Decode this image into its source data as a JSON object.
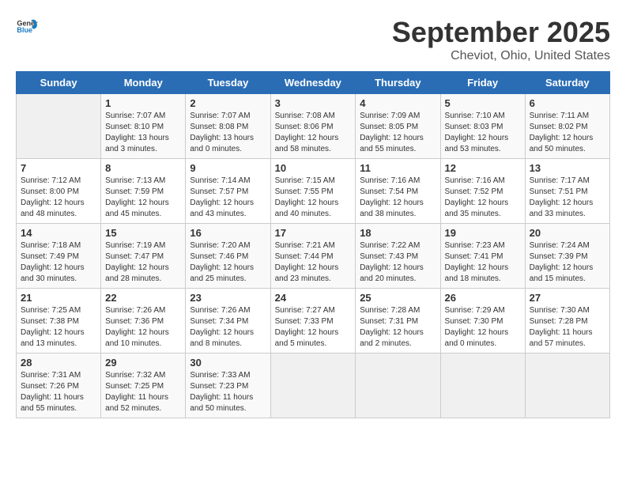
{
  "logo": {
    "general": "General",
    "blue": "Blue"
  },
  "header": {
    "month": "September 2025",
    "location": "Cheviot, Ohio, United States"
  },
  "weekdays": [
    "Sunday",
    "Monday",
    "Tuesday",
    "Wednesday",
    "Thursday",
    "Friday",
    "Saturday"
  ],
  "weeks": [
    [
      {
        "day": "",
        "info": ""
      },
      {
        "day": "1",
        "info": "Sunrise: 7:07 AM\nSunset: 8:10 PM\nDaylight: 13 hours\nand 3 minutes."
      },
      {
        "day": "2",
        "info": "Sunrise: 7:07 AM\nSunset: 8:08 PM\nDaylight: 13 hours\nand 0 minutes."
      },
      {
        "day": "3",
        "info": "Sunrise: 7:08 AM\nSunset: 8:06 PM\nDaylight: 12 hours\nand 58 minutes."
      },
      {
        "day": "4",
        "info": "Sunrise: 7:09 AM\nSunset: 8:05 PM\nDaylight: 12 hours\nand 55 minutes."
      },
      {
        "day": "5",
        "info": "Sunrise: 7:10 AM\nSunset: 8:03 PM\nDaylight: 12 hours\nand 53 minutes."
      },
      {
        "day": "6",
        "info": "Sunrise: 7:11 AM\nSunset: 8:02 PM\nDaylight: 12 hours\nand 50 minutes."
      }
    ],
    [
      {
        "day": "7",
        "info": "Sunrise: 7:12 AM\nSunset: 8:00 PM\nDaylight: 12 hours\nand 48 minutes."
      },
      {
        "day": "8",
        "info": "Sunrise: 7:13 AM\nSunset: 7:59 PM\nDaylight: 12 hours\nand 45 minutes."
      },
      {
        "day": "9",
        "info": "Sunrise: 7:14 AM\nSunset: 7:57 PM\nDaylight: 12 hours\nand 43 minutes."
      },
      {
        "day": "10",
        "info": "Sunrise: 7:15 AM\nSunset: 7:55 PM\nDaylight: 12 hours\nand 40 minutes."
      },
      {
        "day": "11",
        "info": "Sunrise: 7:16 AM\nSunset: 7:54 PM\nDaylight: 12 hours\nand 38 minutes."
      },
      {
        "day": "12",
        "info": "Sunrise: 7:16 AM\nSunset: 7:52 PM\nDaylight: 12 hours\nand 35 minutes."
      },
      {
        "day": "13",
        "info": "Sunrise: 7:17 AM\nSunset: 7:51 PM\nDaylight: 12 hours\nand 33 minutes."
      }
    ],
    [
      {
        "day": "14",
        "info": "Sunrise: 7:18 AM\nSunset: 7:49 PM\nDaylight: 12 hours\nand 30 minutes."
      },
      {
        "day": "15",
        "info": "Sunrise: 7:19 AM\nSunset: 7:47 PM\nDaylight: 12 hours\nand 28 minutes."
      },
      {
        "day": "16",
        "info": "Sunrise: 7:20 AM\nSunset: 7:46 PM\nDaylight: 12 hours\nand 25 minutes."
      },
      {
        "day": "17",
        "info": "Sunrise: 7:21 AM\nSunset: 7:44 PM\nDaylight: 12 hours\nand 23 minutes."
      },
      {
        "day": "18",
        "info": "Sunrise: 7:22 AM\nSunset: 7:43 PM\nDaylight: 12 hours\nand 20 minutes."
      },
      {
        "day": "19",
        "info": "Sunrise: 7:23 AM\nSunset: 7:41 PM\nDaylight: 12 hours\nand 18 minutes."
      },
      {
        "day": "20",
        "info": "Sunrise: 7:24 AM\nSunset: 7:39 PM\nDaylight: 12 hours\nand 15 minutes."
      }
    ],
    [
      {
        "day": "21",
        "info": "Sunrise: 7:25 AM\nSunset: 7:38 PM\nDaylight: 12 hours\nand 13 minutes."
      },
      {
        "day": "22",
        "info": "Sunrise: 7:26 AM\nSunset: 7:36 PM\nDaylight: 12 hours\nand 10 minutes."
      },
      {
        "day": "23",
        "info": "Sunrise: 7:26 AM\nSunset: 7:34 PM\nDaylight: 12 hours\nand 8 minutes."
      },
      {
        "day": "24",
        "info": "Sunrise: 7:27 AM\nSunset: 7:33 PM\nDaylight: 12 hours\nand 5 minutes."
      },
      {
        "day": "25",
        "info": "Sunrise: 7:28 AM\nSunset: 7:31 PM\nDaylight: 12 hours\nand 2 minutes."
      },
      {
        "day": "26",
        "info": "Sunrise: 7:29 AM\nSunset: 7:30 PM\nDaylight: 12 hours\nand 0 minutes."
      },
      {
        "day": "27",
        "info": "Sunrise: 7:30 AM\nSunset: 7:28 PM\nDaylight: 11 hours\nand 57 minutes."
      }
    ],
    [
      {
        "day": "28",
        "info": "Sunrise: 7:31 AM\nSunset: 7:26 PM\nDaylight: 11 hours\nand 55 minutes."
      },
      {
        "day": "29",
        "info": "Sunrise: 7:32 AM\nSunset: 7:25 PM\nDaylight: 11 hours\nand 52 minutes."
      },
      {
        "day": "30",
        "info": "Sunrise: 7:33 AM\nSunset: 7:23 PM\nDaylight: 11 hours\nand 50 minutes."
      },
      {
        "day": "",
        "info": ""
      },
      {
        "day": "",
        "info": ""
      },
      {
        "day": "",
        "info": ""
      },
      {
        "day": "",
        "info": ""
      }
    ]
  ]
}
